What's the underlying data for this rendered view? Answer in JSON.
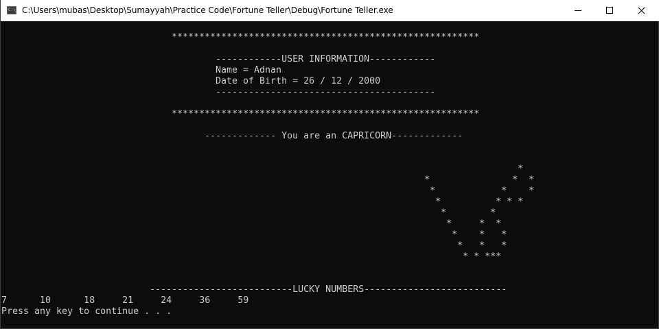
{
  "window": {
    "title": "C:\\Users\\mubas\\Desktop\\Sumayyah\\Practice Code\\Fortune Teller\\Debug\\Fortune Teller.exe",
    "icon": "console-app-icon",
    "icon_text": "C:\\"
  },
  "console": {
    "border_top": "********************************************************",
    "user_info_header": "------------USER INFORMATION------------",
    "name_line": "Name = Adnan",
    "dob_line": "Date of Birth = 26 / 12 / 2000",
    "user_info_footer": "----------------------------------------",
    "border_bottom": "********************************************************",
    "sign_line": "------------- You are an CAPRICORN-------------",
    "art": [
      "                 *",
      "*               *  *",
      " *            *    *",
      "  *          * * *",
      "   *        *",
      "    *     *  *",
      "     *    *   *",
      "      *   *   *",
      "       * * ***"
    ],
    "lucky_header": "--------------------------LUCKY NUMBERS--------------------------",
    "lucky_numbers": "7      10      18     21     24     36     59",
    "prompt": "Press any key to continue . . ."
  }
}
